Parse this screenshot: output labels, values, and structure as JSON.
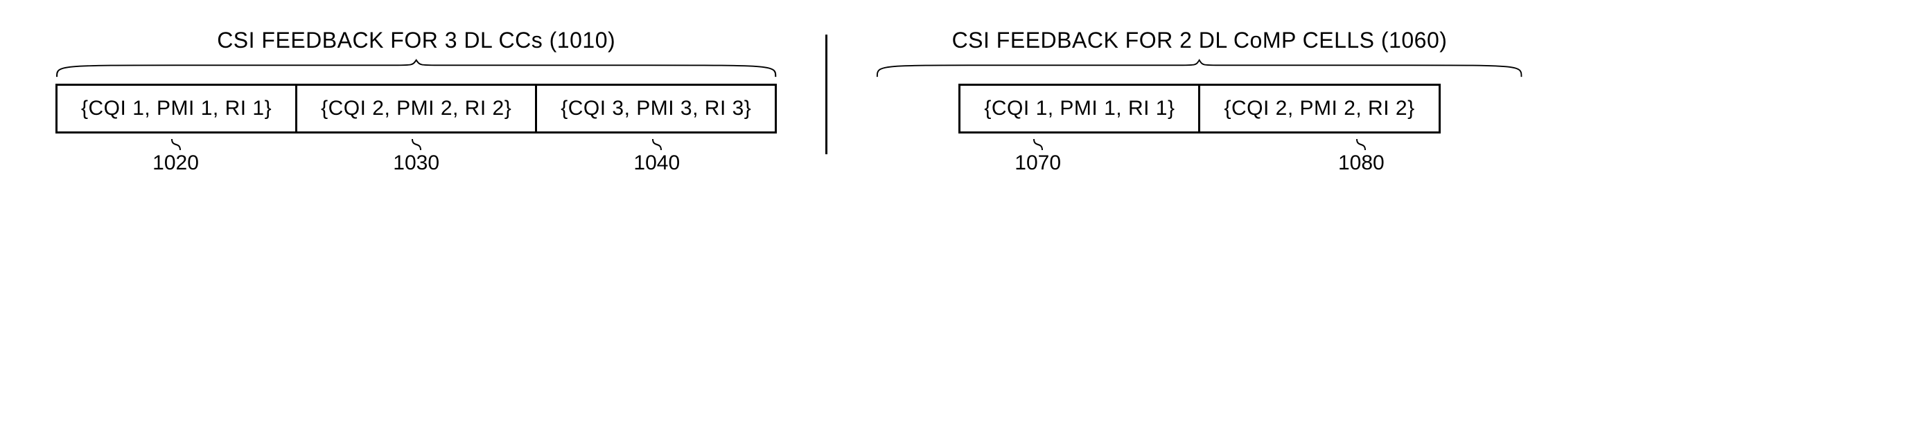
{
  "left": {
    "title": "CSI FEEDBACK FOR 3 DL CCs (1010)",
    "cells": [
      {
        "text": "{CQI 1, PMI 1, RI 1}",
        "ref": "1020"
      },
      {
        "text": "{CQI 2, PMI 2, RI 2}",
        "ref": "1030"
      },
      {
        "text": "{CQI 3, PMI 3, RI 3}",
        "ref": "1040"
      }
    ]
  },
  "right": {
    "title": "CSI FEEDBACK FOR 2 DL CoMP CELLS (1060)",
    "cells": [
      {
        "text": "{CQI 1, PMI 1, RI 1}",
        "ref": "1070"
      },
      {
        "text": "{CQI 2, PMI 2, RI 2}",
        "ref": "1080"
      }
    ]
  }
}
